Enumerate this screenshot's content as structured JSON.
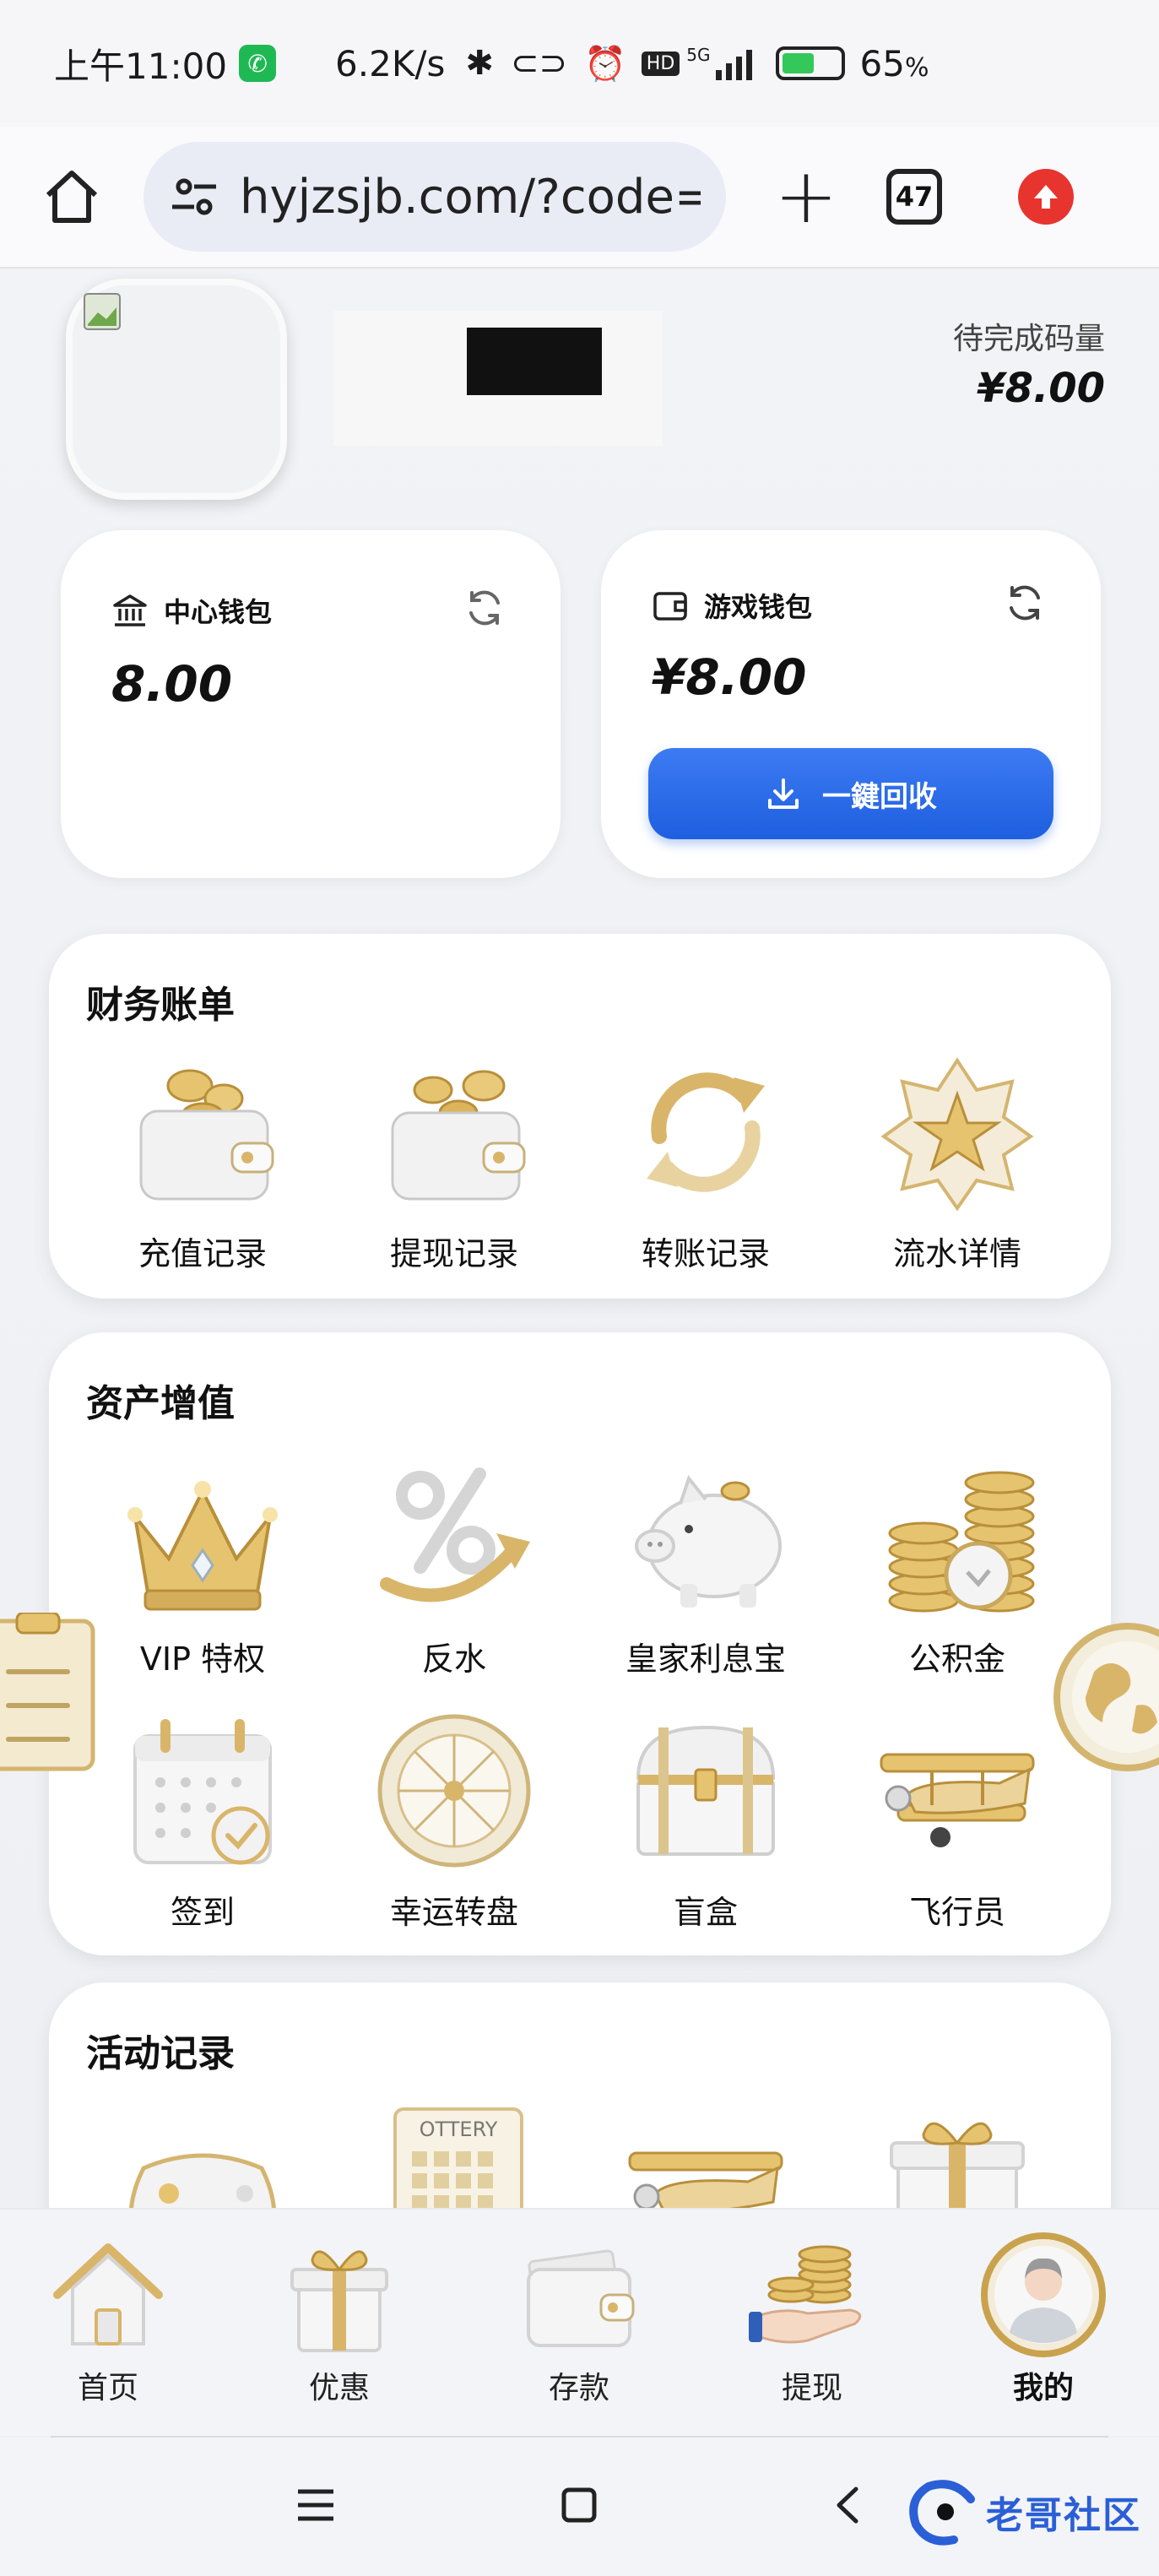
{
  "status_bar": {
    "time": "上午11:00",
    "net_speed": "6.2K/s",
    "network": "5G",
    "hd_label": "HD",
    "battery": "65",
    "battery_unit": "%"
  },
  "browser": {
    "url": "hyjzsjb.com/?code=Z",
    "tab_count": "47"
  },
  "profile": {
    "pending_label": "待完成码量",
    "pending_value": "¥8.00"
  },
  "wallets": {
    "center": {
      "title": "中心钱包",
      "amount": "8.00"
    },
    "game": {
      "title": "游戏钱包",
      "amount": "¥8.00",
      "button_label": "一鍵回收"
    }
  },
  "finance": {
    "title": "财务账单",
    "items": [
      {
        "label": "充值记录",
        "icon": "wallet-coins-icon"
      },
      {
        "label": "提现记录",
        "icon": "wallet-coins-icon"
      },
      {
        "label": "转账记录",
        "icon": "transfer-cycle-icon"
      },
      {
        "label": "流水详情",
        "icon": "star-badge-icon"
      }
    ]
  },
  "assets": {
    "title": "资产增值",
    "items": [
      {
        "label": "VIP 特权",
        "icon": "crown-icon"
      },
      {
        "label": "反水",
        "icon": "percent-arrow-icon"
      },
      {
        "label": "皇家利息宝",
        "icon": "piggy-bank-icon"
      },
      {
        "label": "公积金",
        "icon": "coin-stack-icon"
      },
      {
        "label": "签到",
        "icon": "calendar-check-icon"
      },
      {
        "label": "幸运转盘",
        "icon": "wheel-icon"
      },
      {
        "label": "盲盒",
        "icon": "treasure-chest-icon"
      },
      {
        "label": "飞行员",
        "icon": "airplane-icon"
      }
    ]
  },
  "activity": {
    "title": "活动记录",
    "lottery_text": "OTTERY"
  },
  "bottom_nav": [
    {
      "label": "首页",
      "icon": "home-icon"
    },
    {
      "label": "优惠",
      "icon": "gift-icon"
    },
    {
      "label": "存款",
      "icon": "wallet-icon"
    },
    {
      "label": "提现",
      "icon": "hand-coins-icon"
    },
    {
      "label": "我的",
      "icon": "user-avatar-icon"
    }
  ],
  "watermark": "老哥社区",
  "colors": {
    "accent_blue": "#2563eb",
    "gold": "#d9b56a",
    "card_bg": "#ffffff",
    "page_bg": "#eef0f4"
  }
}
